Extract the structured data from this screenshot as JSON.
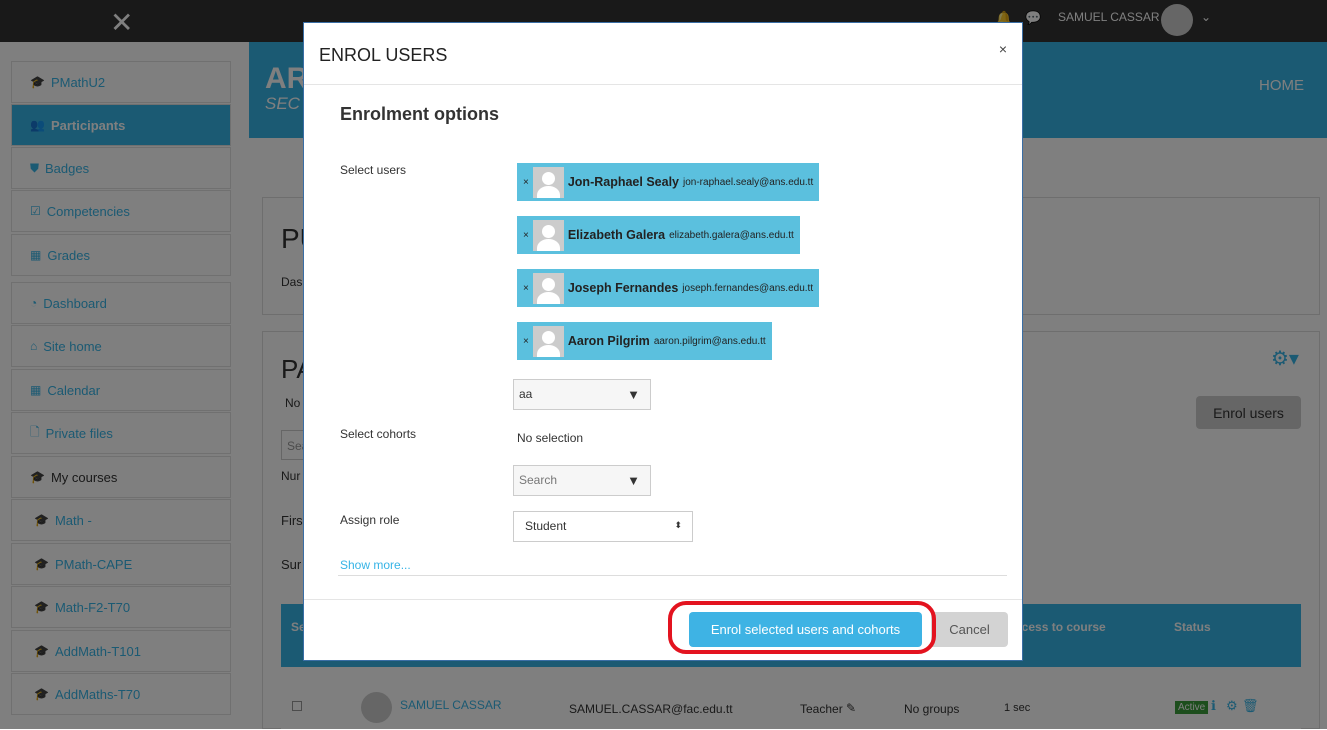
{
  "navbar": {
    "close_icon": "close-icon",
    "user_name": "SAMUEL CASSAR"
  },
  "header": {
    "title_fragment": "AR",
    "subtitle_fragment": "SEC",
    "home": "HOME"
  },
  "sidebar": {
    "items": [
      {
        "label": "PMathU2",
        "icon": "graduation-cap-icon"
      },
      {
        "label": "Participants",
        "icon": "users-icon",
        "active": true
      },
      {
        "label": "Badges",
        "icon": "shield-icon"
      },
      {
        "label": "Competencies",
        "icon": "checkbox-icon"
      },
      {
        "label": "Grades",
        "icon": "table-icon"
      },
      {
        "label": "Dashboard",
        "icon": "dashboard-icon"
      },
      {
        "label": "Site home",
        "icon": "home-icon"
      },
      {
        "label": "Calendar",
        "icon": "calendar-icon"
      },
      {
        "label": "Private files",
        "icon": "file-icon"
      },
      {
        "label": "My courses",
        "icon": "graduation-cap-icon"
      },
      {
        "label": "Math -",
        "icon": "graduation-cap-icon"
      },
      {
        "label": "PMath-CAPE",
        "icon": "graduation-cap-icon"
      },
      {
        "label": "Math-F2-T70",
        "icon": "graduation-cap-icon"
      },
      {
        "label": "AddMath-T101",
        "icon": "graduation-cap-icon"
      },
      {
        "label": "AddMaths-T70",
        "icon": "graduation-cap-icon"
      }
    ]
  },
  "page": {
    "title_fragment": "PU",
    "breadcrumb_fragment": "Das",
    "section_fragment": "PA",
    "no_fragment": "No",
    "search_fragment": "Sea",
    "num_fragment": "Nur",
    "first_fragment": "Firs",
    "sur_fragment": "Sur",
    "enrol_users": "Enrol users",
    "table": {
      "headers": [
        "Se",
        "t access to course",
        "Status"
      ],
      "rows": [
        {
          "name": "SAMUEL CASSAR",
          "email": "SAMUEL.CASSAR@fac.edu.tt",
          "role": "Teacher",
          "groups": "No groups",
          "access": "1 sec",
          "status": "Active"
        }
      ]
    }
  },
  "modal": {
    "title": "ENROL USERS",
    "close": "×",
    "section": "Enrolment options",
    "select_users_label": "Select users",
    "users": [
      {
        "name": "Jon-Raphael Sealy",
        "email": "jon-raphael.sealy@ans.edu.tt"
      },
      {
        "name": "Elizabeth Galera",
        "email": "elizabeth.galera@ans.edu.tt"
      },
      {
        "name": "Joseph Fernandes",
        "email": "joseph.fernandes@ans.edu.tt"
      },
      {
        "name": "Aaron Pilgrim",
        "email": "aaron.pilgrim@ans.edu.tt"
      }
    ],
    "remove": "×",
    "user_search_value": "aa",
    "select_cohorts_label": "Select cohorts",
    "cohorts_value": "No selection",
    "cohort_search_placeholder": "Search",
    "assign_role_label": "Assign role",
    "role_value": "Student",
    "show_more": "Show more...",
    "enrol_button": "Enrol selected users and cohorts",
    "cancel_button": "Cancel"
  },
  "colors": {
    "accent": "#37b4e6",
    "chip": "#5bc0de",
    "highlight": "#e3131f",
    "active_badge": "#3a9d3a"
  }
}
